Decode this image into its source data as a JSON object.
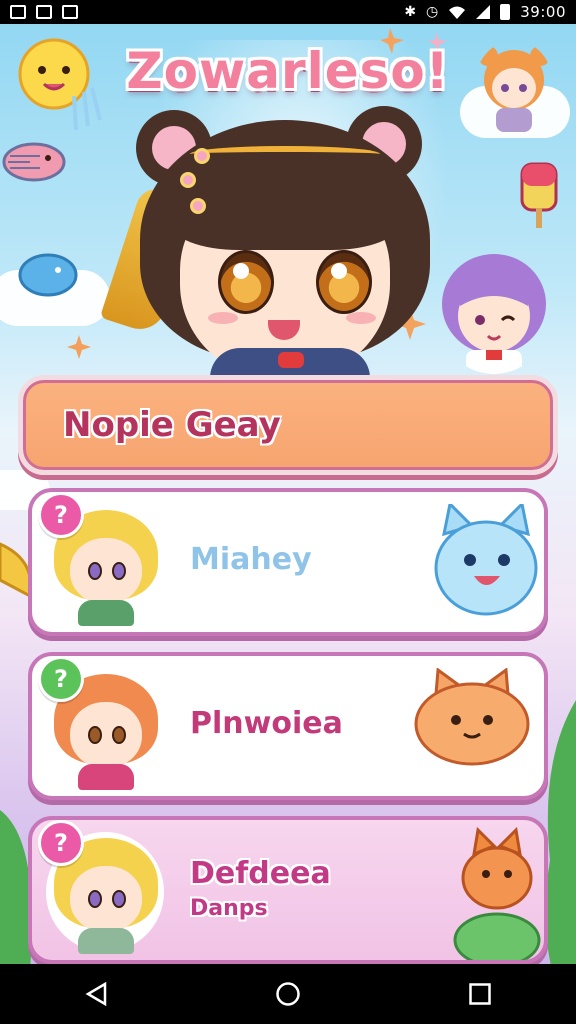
{
  "status_bar": {
    "time": "39:00"
  },
  "app": {
    "title": "Zowarleso!"
  },
  "primary_banner": {
    "label": "Nopie Geay"
  },
  "cards": [
    {
      "name": "Miahey",
      "name_color": "#8fc4e8",
      "sub": "",
      "badge_color": "#ea5aa6",
      "badge": "?"
    },
    {
      "name": "Plnwoiea",
      "name_color": "#c23a7a",
      "sub": "",
      "badge_color": "#5cc35a",
      "badge": "?"
    },
    {
      "name": "Defdeea",
      "name_color": "#c23a86",
      "sub": "Danps",
      "badge_color": "#ea5aa6",
      "badge": "?"
    }
  ],
  "colors": {
    "accent": "#f3809c",
    "card_border": "#c777b8",
    "banner": "#f7a46f"
  },
  "icons": [
    "back-icon",
    "home-icon",
    "recents-icon",
    "wifi-icon",
    "battery-icon",
    "alarm-icon",
    "bluetooth-icon"
  ]
}
